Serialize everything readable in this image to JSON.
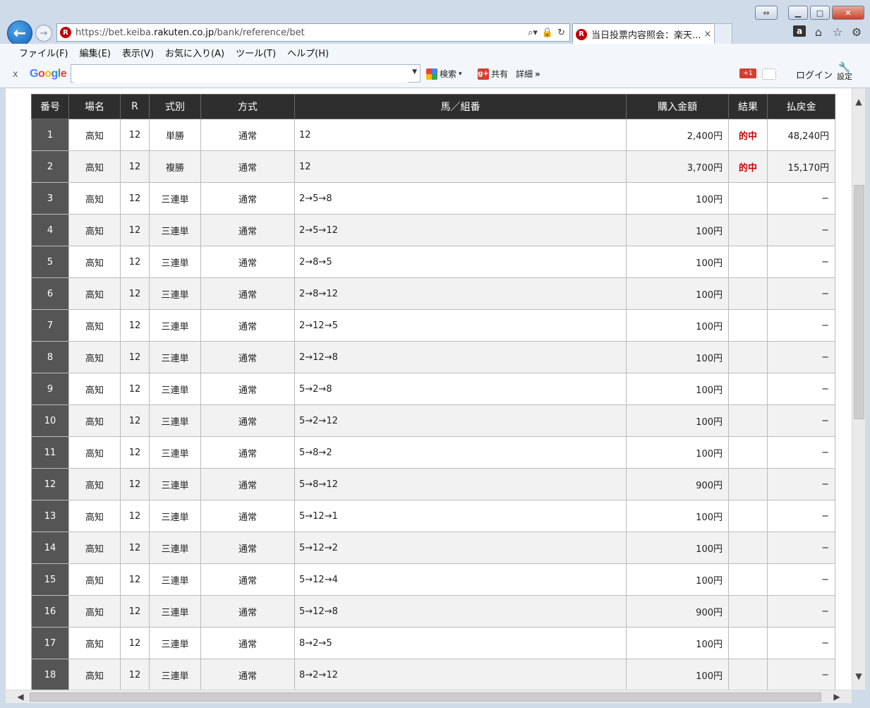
{
  "browser": {
    "url_prefix": "https://bet.keiba.",
    "url_domain": "rakuten.co.jp",
    "url_path": "/bank/reference/bet",
    "tab_title": "当日投票内容照会：楽天...",
    "tab_close": "×"
  },
  "menu": [
    "ファイル(F)",
    "編集(E)",
    "表示(V)",
    "お気に入り(A)",
    "ツール(T)",
    "ヘルプ(H)"
  ],
  "google_toolbar": {
    "close": "x",
    "logo": "Google",
    "search_value": "",
    "search_btn": "検索",
    "share_btn": "共有",
    "more_btn": "詳細",
    "more_glyph": "»",
    "plus_badge": "+1",
    "login": "ログイン",
    "settings": "設定"
  },
  "table": {
    "headers": [
      "番号",
      "場名",
      "R",
      "式別",
      "方式",
      "馬／組番",
      "購入金額",
      "結果",
      "払戻金"
    ],
    "rows": [
      [
        "1",
        "高知",
        "12",
        "単勝",
        "通常",
        "12",
        "2,400円",
        "的中",
        "48,240円"
      ],
      [
        "2",
        "高知",
        "12",
        "複勝",
        "通常",
        "12",
        "3,700円",
        "的中",
        "15,170円"
      ],
      [
        "3",
        "高知",
        "12",
        "三連単",
        "通常",
        "2→5→8",
        "100円",
        "",
        "−"
      ],
      [
        "4",
        "高知",
        "12",
        "三連単",
        "通常",
        "2→5→12",
        "100円",
        "",
        "−"
      ],
      [
        "5",
        "高知",
        "12",
        "三連単",
        "通常",
        "2→8→5",
        "100円",
        "",
        "−"
      ],
      [
        "6",
        "高知",
        "12",
        "三連単",
        "通常",
        "2→8→12",
        "100円",
        "",
        "−"
      ],
      [
        "7",
        "高知",
        "12",
        "三連単",
        "通常",
        "2→12→5",
        "100円",
        "",
        "−"
      ],
      [
        "8",
        "高知",
        "12",
        "三連単",
        "通常",
        "2→12→8",
        "100円",
        "",
        "−"
      ],
      [
        "9",
        "高知",
        "12",
        "三連単",
        "通常",
        "5→2→8",
        "100円",
        "",
        "−"
      ],
      [
        "10",
        "高知",
        "12",
        "三連単",
        "通常",
        "5→2→12",
        "100円",
        "",
        "−"
      ],
      [
        "11",
        "高知",
        "12",
        "三連単",
        "通常",
        "5→8→2",
        "100円",
        "",
        "−"
      ],
      [
        "12",
        "高知",
        "12",
        "三連単",
        "通常",
        "5→8→12",
        "900円",
        "",
        "−"
      ],
      [
        "13",
        "高知",
        "12",
        "三連単",
        "通常",
        "5→12→1",
        "100円",
        "",
        "−"
      ],
      [
        "14",
        "高知",
        "12",
        "三連単",
        "通常",
        "5→12→2",
        "100円",
        "",
        "−"
      ],
      [
        "15",
        "高知",
        "12",
        "三連単",
        "通常",
        "5→12→4",
        "100円",
        "",
        "−"
      ],
      [
        "16",
        "高知",
        "12",
        "三連単",
        "通常",
        "5→12→8",
        "900円",
        "",
        "−"
      ],
      [
        "17",
        "高知",
        "12",
        "三連単",
        "通常",
        "8→2→5",
        "100円",
        "",
        "−"
      ],
      [
        "18",
        "高知",
        "12",
        "三連単",
        "通常",
        "8→2→12",
        "100円",
        "",
        "−"
      ]
    ]
  }
}
